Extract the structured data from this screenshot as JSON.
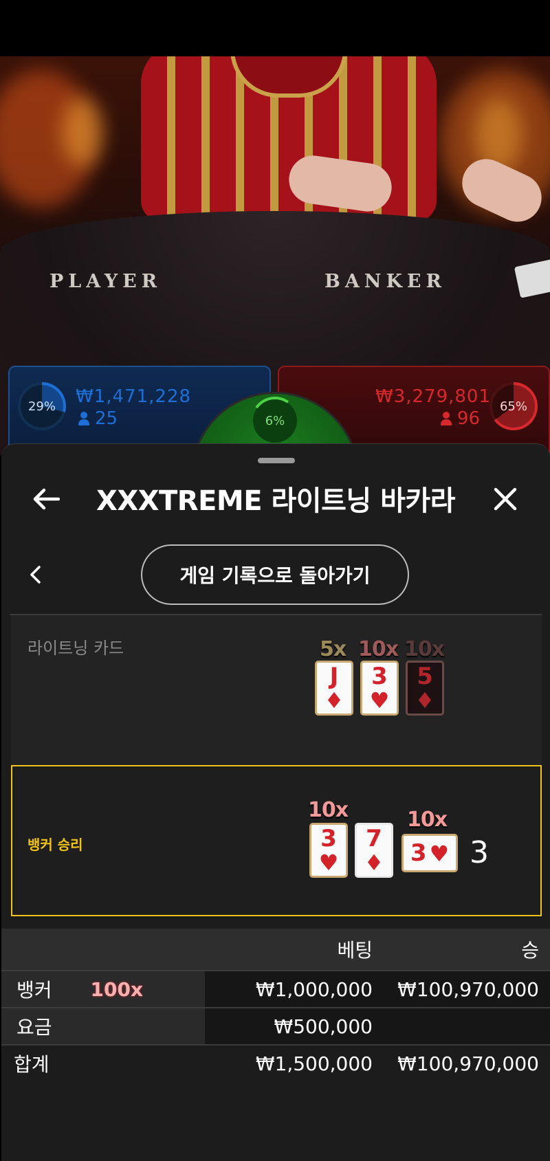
{
  "video": {
    "table_label_player": "PLAYER",
    "table_label_banker": "BANKER"
  },
  "bets": {
    "player": {
      "percent": "29%",
      "amount": "₩1,471,228",
      "count": "25"
    },
    "tie": {
      "percent": "6%"
    },
    "banker": {
      "amount": "₩3,279,801",
      "count": "96",
      "percent": "65%"
    }
  },
  "colors": {
    "player_blue": "#1d6fd6",
    "banker_red": "#d6282d",
    "tie_green": "#4cd246",
    "highlight_yellow": "#f0c419",
    "lightning_gold": "#c9a871"
  },
  "header": {
    "back_icon": "arrow-left-icon",
    "title": "XXXTREME 라이트닝 바카라",
    "close_icon": "close-icon"
  },
  "nav": {
    "prev_icon": "chevron-left-icon",
    "history_button_label": "게임 기록으로 돌아가기"
  },
  "lightning_cards": {
    "label": "라이트닝 카드",
    "cards": [
      {
        "rank": "J",
        "suit": "♦",
        "multiplier": "5x",
        "highlight": true
      },
      {
        "rank": "3",
        "suit": "♥",
        "multiplier": "10x",
        "highlight": true
      },
      {
        "rank": "5",
        "suit": "♦",
        "multiplier": "10x",
        "highlight": false
      }
    ]
  },
  "result": {
    "label": "뱅커 승리",
    "score": "3",
    "cards": [
      {
        "rank": "3",
        "suit": "♥",
        "multiplier": "10x"
      },
      {
        "rank": "7",
        "suit": "♦",
        "multiplier": ""
      },
      {
        "rank": "3",
        "suit": "♥",
        "multiplier": "10x"
      }
    ]
  },
  "table": {
    "headers": {
      "bet": "베팅",
      "win": "승"
    },
    "rows": [
      {
        "label": "뱅커",
        "multiplier": "100x",
        "bet": "₩1,000,000",
        "win": "₩100,970,000"
      },
      {
        "label": "요금",
        "multiplier": "",
        "bet": "₩500,000",
        "win": ""
      }
    ],
    "total": {
      "label": "합계",
      "bet": "₩1,500,000",
      "win": "₩100,970,000"
    }
  }
}
